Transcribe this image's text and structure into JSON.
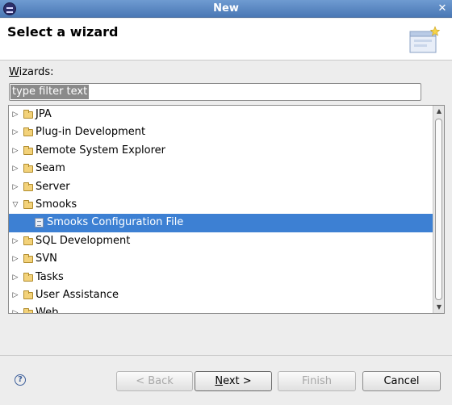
{
  "window": {
    "title": "New"
  },
  "header": {
    "heading": "Select a wizard"
  },
  "wizards_label": {
    "mnemonic": "W",
    "rest": "izards:"
  },
  "filter": {
    "value": "type filter text"
  },
  "tree": {
    "items": [
      {
        "label": "JPA",
        "expanded": false,
        "level": 0,
        "icon": "folder-icon"
      },
      {
        "label": "Plug-in Development",
        "expanded": false,
        "level": 0,
        "icon": "folder-icon"
      },
      {
        "label": "Remote System Explorer",
        "expanded": false,
        "level": 0,
        "icon": "folder-icon"
      },
      {
        "label": "Seam",
        "expanded": false,
        "level": 0,
        "icon": "folder-icon"
      },
      {
        "label": "Server",
        "expanded": false,
        "level": 0,
        "icon": "folder-icon"
      },
      {
        "label": "Smooks",
        "expanded": true,
        "level": 0,
        "icon": "folder-icon"
      },
      {
        "label": "Smooks Configuration File",
        "level": 1,
        "icon": "file-icon",
        "selected": true
      },
      {
        "label": "SQL Development",
        "expanded": false,
        "level": 0,
        "icon": "folder-icon"
      },
      {
        "label": "SVN",
        "expanded": false,
        "level": 0,
        "icon": "folder-icon"
      },
      {
        "label": "Tasks",
        "expanded": false,
        "level": 0,
        "icon": "folder-icon"
      },
      {
        "label": "User Assistance",
        "expanded": false,
        "level": 0,
        "icon": "folder-icon"
      },
      {
        "label": "Web",
        "expanded": false,
        "level": 0,
        "icon": "folder-icon"
      }
    ]
  },
  "buttons": {
    "back": "< Back",
    "next": "Next >",
    "finish": "Finish",
    "cancel": "Cancel"
  },
  "colors": {
    "selection": "#3d80d3",
    "titlebar": "#4a78b5"
  }
}
